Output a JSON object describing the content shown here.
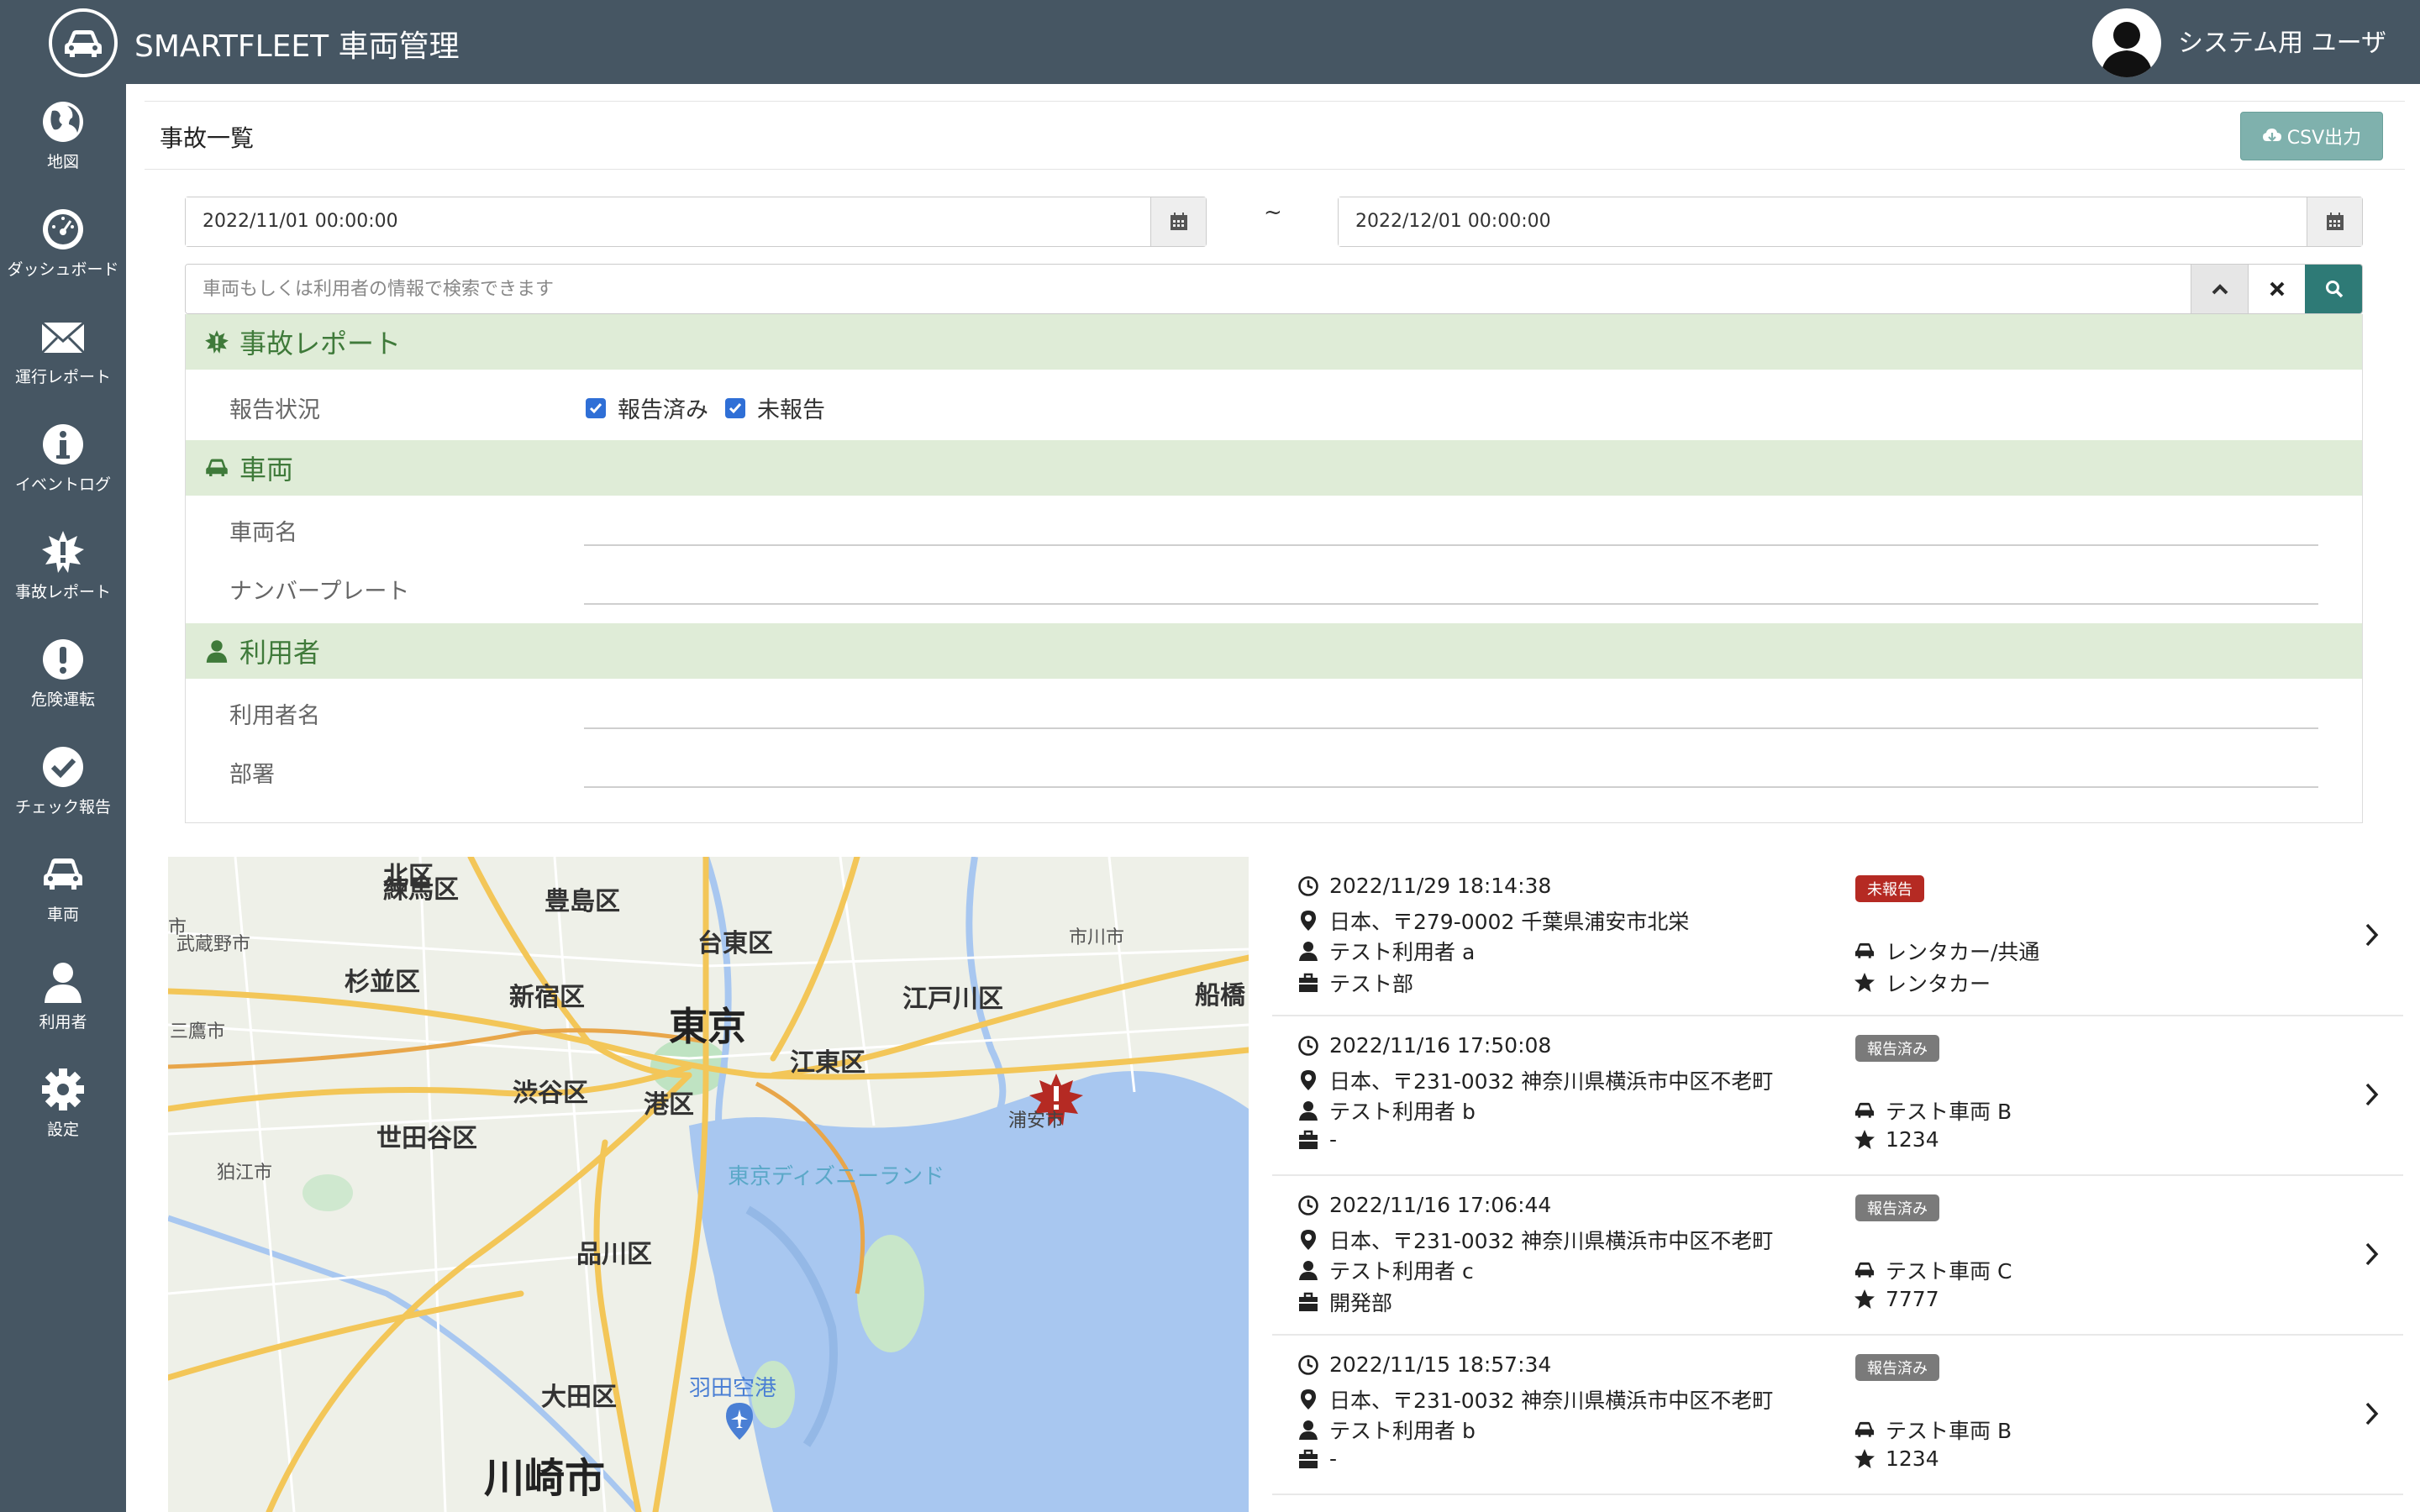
{
  "app": {
    "title": "SMARTFLEET 車両管理",
    "user_name": "システム用 ユーザ"
  },
  "sidebar": {
    "items": [
      {
        "label": "地図",
        "icon": "globe-icon"
      },
      {
        "label": "ダッシュボード",
        "icon": "dashboard-icon"
      },
      {
        "label": "運行レポート",
        "icon": "envelope-icon"
      },
      {
        "label": "イベントログ",
        "icon": "info-icon"
      },
      {
        "label": "事故レポート",
        "icon": "accident-icon"
      },
      {
        "label": "危険運転",
        "icon": "warning-icon"
      },
      {
        "label": "チェック報告",
        "icon": "check-icon"
      },
      {
        "label": "車両",
        "icon": "car-icon"
      },
      {
        "label": "利用者",
        "icon": "user-icon"
      },
      {
        "label": "設定",
        "icon": "gear-icon"
      }
    ]
  },
  "header": {
    "title": "事故一覧",
    "csv_label": "CSV出力"
  },
  "filters": {
    "date_from": "2022/11/01 00:00:00",
    "date_to": "2022/12/01 00:00:00",
    "range_separator": "~",
    "search_placeholder": "車両もしくは利用者の情報で検索できます",
    "sections": {
      "accident": {
        "title": "事故レポート",
        "status_label": "報告状況",
        "options": [
          {
            "label": "報告済み",
            "checked": true
          },
          {
            "label": "未報告",
            "checked": true
          }
        ]
      },
      "vehicle": {
        "title": "車両",
        "name_label": "車両名",
        "plate_label": "ナンバープレート"
      },
      "user": {
        "title": "利用者",
        "name_label": "利用者名",
        "dept_label": "部署"
      }
    }
  },
  "map": {
    "labels": [
      "練馬区",
      "豊島区",
      "北区",
      "台東区",
      "市川市",
      "武蔵野市",
      "杉並区",
      "新宿区",
      "江戸川区",
      "船橋",
      "東京",
      "三鷹市",
      "江東区",
      "渋谷区",
      "港区",
      "浦安市",
      "世田谷区",
      "狛江市",
      "東京ディズニーランド",
      "品川区",
      "大田区",
      "羽田空港",
      "川崎市",
      "市"
    ],
    "marker_icon": "accident-marker-icon"
  },
  "accidents": [
    {
      "datetime": "2022/11/29 18:14:38",
      "address": "日本、〒279-0002 千葉県浦安市北栄",
      "user": "テスト利用者 a",
      "dept": "テスト部",
      "status": "未報告",
      "status_color": "#b52a23",
      "vehicle": "レンタカー/共通",
      "plate": "レンタカー"
    },
    {
      "datetime": "2022/11/16 17:50:08",
      "address": "日本、〒231-0032 神奈川県横浜市中区不老町",
      "user": "テスト利用者 b",
      "dept": "-",
      "status": "報告済み",
      "status_color": "#7a7a7a",
      "vehicle": "テスト車両 B",
      "plate": "1234"
    },
    {
      "datetime": "2022/11/16 17:06:44",
      "address": "日本、〒231-0032 神奈川県横浜市中区不老町",
      "user": "テスト利用者 c",
      "dept": "開発部",
      "status": "報告済み",
      "status_color": "#7a7a7a",
      "vehicle": "テスト車両 C",
      "plate": "7777"
    },
    {
      "datetime": "2022/11/15 18:57:34",
      "address": "日本、〒231-0032 神奈川県横浜市中区不老町",
      "user": "テスト利用者 b",
      "dept": "-",
      "status": "報告済み",
      "status_color": "#7a7a7a",
      "vehicle": "テスト車両 B",
      "plate": "1234"
    }
  ]
}
